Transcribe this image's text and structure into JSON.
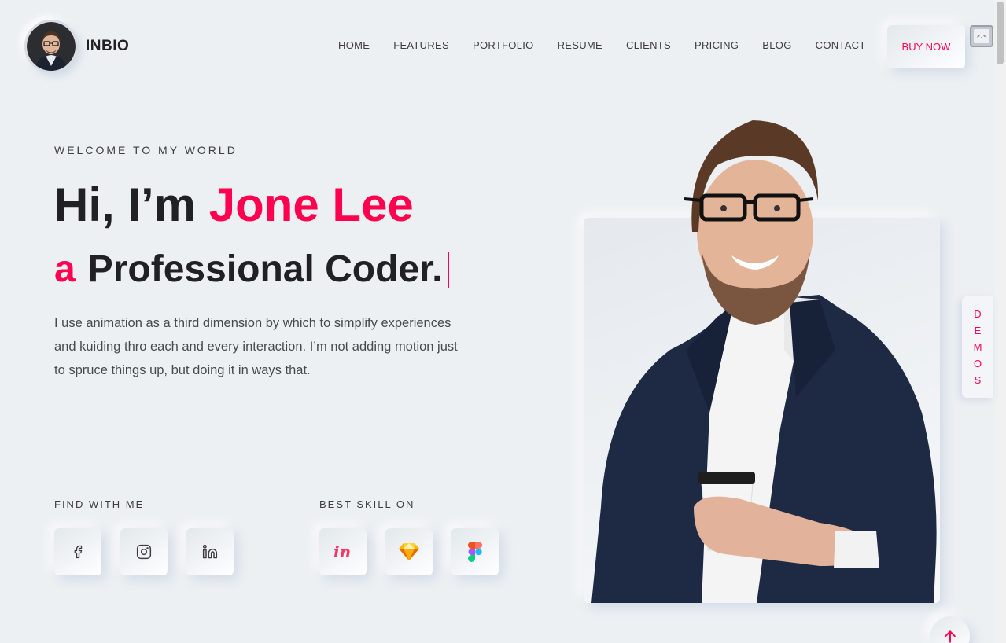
{
  "brand": {
    "name": "INBIO"
  },
  "nav": {
    "items": [
      "HOME",
      "FEATURES",
      "PORTFOLIO",
      "RESUME",
      "CLIENTS",
      "PRICING",
      "BLOG",
      "CONTACT"
    ],
    "buy_label": "BUY NOW"
  },
  "hero": {
    "welcome": "WELCOME TO MY WORLD",
    "greeting": "Hi, I’m ",
    "name": "Jone Lee",
    "prefix": "a",
    "role": "Professional Coder.",
    "description": "I use animation as a third dimension by which to simplify experiences and kuiding thro each and every interaction. I’m not adding motion just to spruce things up, but doing it in ways that."
  },
  "social": {
    "label": "FIND WITH ME",
    "icons": [
      "facebook-icon",
      "instagram-icon",
      "linkedin-icon"
    ]
  },
  "skills": {
    "label": "BEST SKILL ON",
    "icons": [
      "invision-icon",
      "sketch-icon",
      "figma-icon"
    ]
  },
  "demos": {
    "letters": [
      "D",
      "E",
      "M",
      "O",
      "S"
    ]
  },
  "colors": {
    "accent": "#ff014f",
    "background": "#ecf0f3",
    "heading": "#1f2124",
    "text": "#3c3e41"
  }
}
